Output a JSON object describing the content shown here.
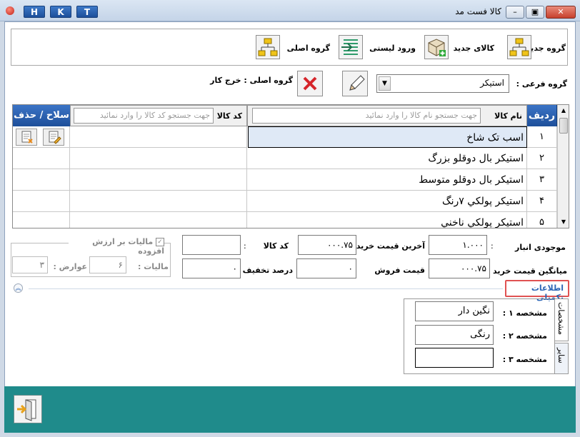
{
  "window": {
    "title": "کالا فست مد",
    "hkt": [
      "H",
      "K",
      "T"
    ],
    "controls": {
      "minimize": "▭",
      "maximize": "▣",
      "close": "✕"
    }
  },
  "toolbar": {
    "new_group": "گروه جدید",
    "new_item": "کالای جدید",
    "list_import": "ورود لیستی",
    "main_group": "گروه اصلی"
  },
  "filters": {
    "subgroup_label": "گروه فرعی :",
    "subgroup_value": "استیکر",
    "main_group_label": "گروه اصلی : ",
    "main_group_value": "خرج کار"
  },
  "grid": {
    "headers": {
      "row": "ردیف",
      "name": "نام کالا",
      "name_placeholder": "جهت جستجو نام کالا را وارد نمائید",
      "code": "کد کالا",
      "code_placeholder": "جهت جستجو کد کالا را وارد نمائید",
      "actions": "سلاح / حذف"
    },
    "rows": [
      {
        "num": "١",
        "name": "اسب تک شاخ"
      },
      {
        "num": "٢",
        "name": "استیکر بال دوقلو بزرگ"
      },
      {
        "num": "٣",
        "name": "استیکر بال دوقلو متوسط"
      },
      {
        "num": "۴",
        "name": "استیکر پولکي ٧رنگ"
      },
      {
        "num": "۵",
        "name": "استیکر پولکي ناخني"
      }
    ]
  },
  "details": {
    "stock_label": "موجودی انبار",
    "stock_value": "١.٠٠٠",
    "last_buy_label": "آخرین قیمت خرید :",
    "last_buy_value": "٧۵.٠٠٠",
    "code_label": "کد کالا",
    "code_colon": ":",
    "code_value": "",
    "avg_buy_label": "میانگین قیمت خرید :",
    "avg_buy_value": "٧۵.٠٠٠",
    "sell_label": "قیمت فروش",
    "sell_value": "٠",
    "discount_label": "درصد تخفیف",
    "discount_value": "٠",
    "vat_label": "مالیات بر ارزش افزوده",
    "tax_label": "مالیات :",
    "tax_value": "۶",
    "duties_label": "عوارض :",
    "duties_value": "٣",
    "extra_info_label": "اطلاعات تکمیلی"
  },
  "specs": {
    "tab_specs": "مشخصات",
    "tab_other": "سایر",
    "items": [
      {
        "label": "مشخصه ١ :",
        "value": "نگین دار"
      },
      {
        "label": "مشخصه ٢ :",
        "value": "رنگی"
      },
      {
        "label": "مشخصه ٣ :",
        "value": ""
      }
    ]
  },
  "colors": {
    "footer": "#1f8b8b",
    "accent": "#2b65b5",
    "highlight": "#e05252"
  }
}
